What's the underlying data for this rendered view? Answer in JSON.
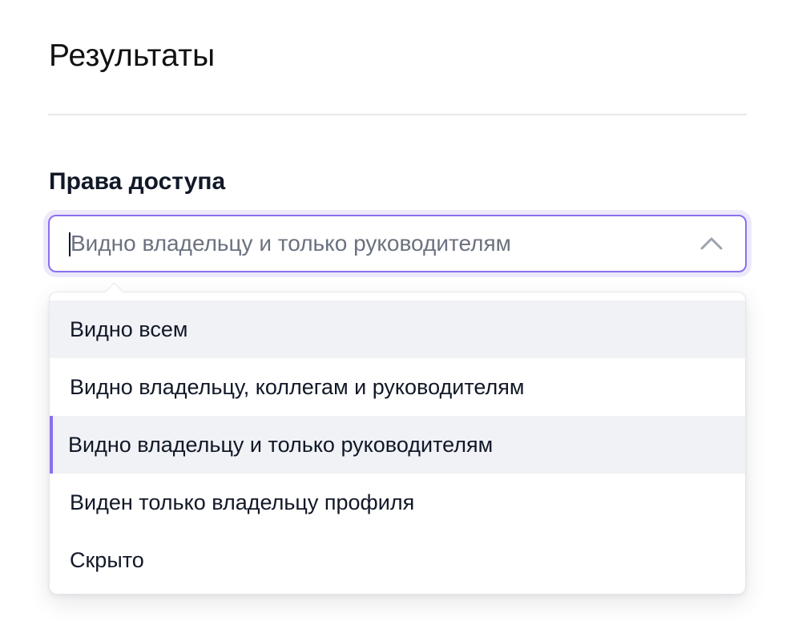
{
  "section": {
    "title": "Результаты"
  },
  "access_field": {
    "label": "Права доступа",
    "placeholder": "Видно владельцу и только руководителям",
    "value": "",
    "expanded": true,
    "chevron_icon": "chevron-up-icon"
  },
  "dropdown": {
    "options": [
      {
        "label": "Видно всем",
        "state": "hovered"
      },
      {
        "label": "Видно владельцу, коллегам и руководителям",
        "state": "default"
      },
      {
        "label": "Видно владельцу и только руководителям",
        "state": "selected"
      },
      {
        "label": "Виден только владельцу профиля",
        "state": "default"
      },
      {
        "label": "Скрыто",
        "state": "default"
      }
    ]
  },
  "colors": {
    "accent": "#8b6ff0",
    "focus_ring": "#ede9fb",
    "highlight_bg": "#f1f2f6",
    "text": "#111827",
    "placeholder": "#6b7280",
    "divider": "#e5e7eb"
  }
}
